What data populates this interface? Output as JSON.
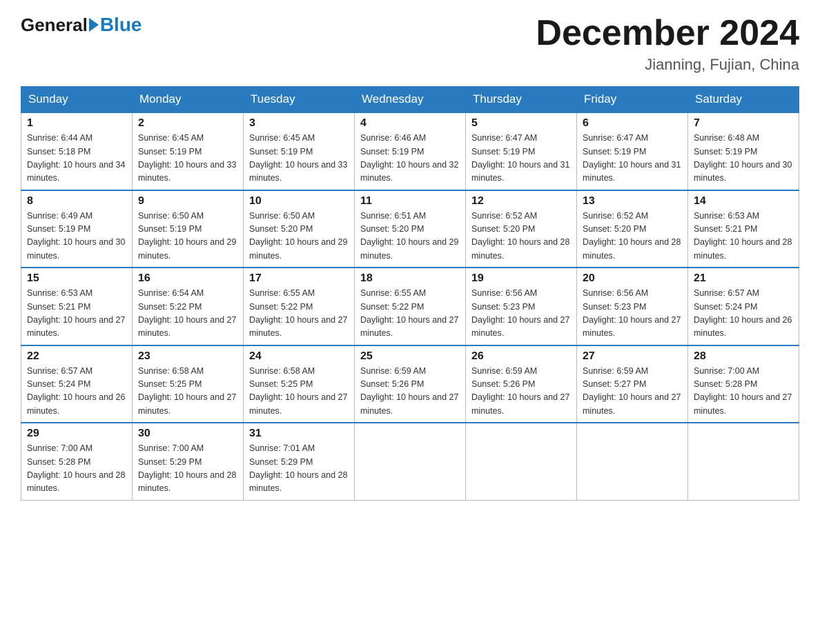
{
  "header": {
    "logo_general": "General",
    "logo_blue": "Blue",
    "month_title": "December 2024",
    "location": "Jianning, Fujian, China"
  },
  "days_of_week": [
    "Sunday",
    "Monday",
    "Tuesday",
    "Wednesday",
    "Thursday",
    "Friday",
    "Saturday"
  ],
  "weeks": [
    [
      {
        "day": "1",
        "sunrise": "6:44 AM",
        "sunset": "5:18 PM",
        "daylight": "10 hours and 34 minutes."
      },
      {
        "day": "2",
        "sunrise": "6:45 AM",
        "sunset": "5:19 PM",
        "daylight": "10 hours and 33 minutes."
      },
      {
        "day": "3",
        "sunrise": "6:45 AM",
        "sunset": "5:19 PM",
        "daylight": "10 hours and 33 minutes."
      },
      {
        "day": "4",
        "sunrise": "6:46 AM",
        "sunset": "5:19 PM",
        "daylight": "10 hours and 32 minutes."
      },
      {
        "day": "5",
        "sunrise": "6:47 AM",
        "sunset": "5:19 PM",
        "daylight": "10 hours and 31 minutes."
      },
      {
        "day": "6",
        "sunrise": "6:47 AM",
        "sunset": "5:19 PM",
        "daylight": "10 hours and 31 minutes."
      },
      {
        "day": "7",
        "sunrise": "6:48 AM",
        "sunset": "5:19 PM",
        "daylight": "10 hours and 30 minutes."
      }
    ],
    [
      {
        "day": "8",
        "sunrise": "6:49 AM",
        "sunset": "5:19 PM",
        "daylight": "10 hours and 30 minutes."
      },
      {
        "day": "9",
        "sunrise": "6:50 AM",
        "sunset": "5:19 PM",
        "daylight": "10 hours and 29 minutes."
      },
      {
        "day": "10",
        "sunrise": "6:50 AM",
        "sunset": "5:20 PM",
        "daylight": "10 hours and 29 minutes."
      },
      {
        "day": "11",
        "sunrise": "6:51 AM",
        "sunset": "5:20 PM",
        "daylight": "10 hours and 29 minutes."
      },
      {
        "day": "12",
        "sunrise": "6:52 AM",
        "sunset": "5:20 PM",
        "daylight": "10 hours and 28 minutes."
      },
      {
        "day": "13",
        "sunrise": "6:52 AM",
        "sunset": "5:20 PM",
        "daylight": "10 hours and 28 minutes."
      },
      {
        "day": "14",
        "sunrise": "6:53 AM",
        "sunset": "5:21 PM",
        "daylight": "10 hours and 28 minutes."
      }
    ],
    [
      {
        "day": "15",
        "sunrise": "6:53 AM",
        "sunset": "5:21 PM",
        "daylight": "10 hours and 27 minutes."
      },
      {
        "day": "16",
        "sunrise": "6:54 AM",
        "sunset": "5:22 PM",
        "daylight": "10 hours and 27 minutes."
      },
      {
        "day": "17",
        "sunrise": "6:55 AM",
        "sunset": "5:22 PM",
        "daylight": "10 hours and 27 minutes."
      },
      {
        "day": "18",
        "sunrise": "6:55 AM",
        "sunset": "5:22 PM",
        "daylight": "10 hours and 27 minutes."
      },
      {
        "day": "19",
        "sunrise": "6:56 AM",
        "sunset": "5:23 PM",
        "daylight": "10 hours and 27 minutes."
      },
      {
        "day": "20",
        "sunrise": "6:56 AM",
        "sunset": "5:23 PM",
        "daylight": "10 hours and 27 minutes."
      },
      {
        "day": "21",
        "sunrise": "6:57 AM",
        "sunset": "5:24 PM",
        "daylight": "10 hours and 26 minutes."
      }
    ],
    [
      {
        "day": "22",
        "sunrise": "6:57 AM",
        "sunset": "5:24 PM",
        "daylight": "10 hours and 26 minutes."
      },
      {
        "day": "23",
        "sunrise": "6:58 AM",
        "sunset": "5:25 PM",
        "daylight": "10 hours and 27 minutes."
      },
      {
        "day": "24",
        "sunrise": "6:58 AM",
        "sunset": "5:25 PM",
        "daylight": "10 hours and 27 minutes."
      },
      {
        "day": "25",
        "sunrise": "6:59 AM",
        "sunset": "5:26 PM",
        "daylight": "10 hours and 27 minutes."
      },
      {
        "day": "26",
        "sunrise": "6:59 AM",
        "sunset": "5:26 PM",
        "daylight": "10 hours and 27 minutes."
      },
      {
        "day": "27",
        "sunrise": "6:59 AM",
        "sunset": "5:27 PM",
        "daylight": "10 hours and 27 minutes."
      },
      {
        "day": "28",
        "sunrise": "7:00 AM",
        "sunset": "5:28 PM",
        "daylight": "10 hours and 27 minutes."
      }
    ],
    [
      {
        "day": "29",
        "sunrise": "7:00 AM",
        "sunset": "5:28 PM",
        "daylight": "10 hours and 28 minutes."
      },
      {
        "day": "30",
        "sunrise": "7:00 AM",
        "sunset": "5:29 PM",
        "daylight": "10 hours and 28 minutes."
      },
      {
        "day": "31",
        "sunrise": "7:01 AM",
        "sunset": "5:29 PM",
        "daylight": "10 hours and 28 minutes."
      },
      null,
      null,
      null,
      null
    ]
  ],
  "labels": {
    "sunrise_prefix": "Sunrise: ",
    "sunset_prefix": "Sunset: ",
    "daylight_prefix": "Daylight: "
  }
}
